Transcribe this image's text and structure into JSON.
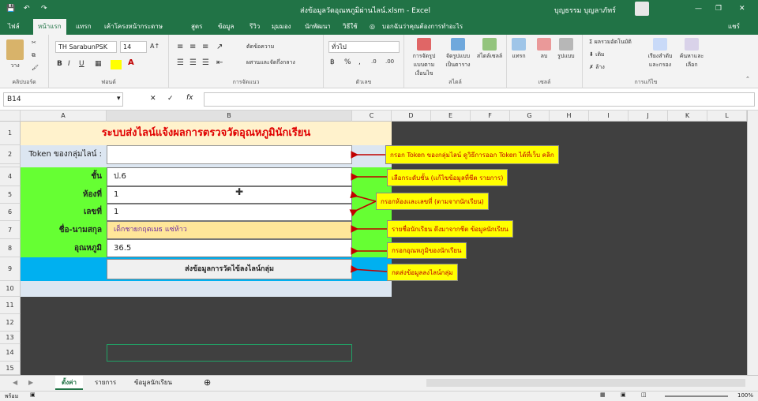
{
  "title_bar": {
    "doc_title": "ส่งข้อมูลวัดอุณหภูมิผ่านไลน์.xlsm - Excel",
    "user_name": "บุญธรรม บุญลาภัทร์",
    "min": "—",
    "restore": "❐",
    "close": "✕",
    "save_icon": "save-icon",
    "undo_icon": "undo-icon",
    "redo_icon": "redo-icon"
  },
  "ribbon_tabs": [
    "ไฟล์",
    "หน้าแรก",
    "แทรก",
    "เค้าโครงหน้ากระดาษ",
    "สูตร",
    "ข้อมูล",
    "รีวิว",
    "มุมมอง",
    "นักพัฒนา",
    "วิธีใช้"
  ],
  "tell_me": "บอกฉันว่าคุณต้องการทำอะไร",
  "share_label": "แชร์",
  "ribbon": {
    "clipboard": {
      "paste": "วาง",
      "label": "คลิปบอร์ด"
    },
    "font": {
      "name": "TH SarabunPSK",
      "size": "14",
      "label": "ฟอนต์",
      "bold": "B",
      "italic": "I",
      "underline": "U"
    },
    "alignment": {
      "wrap": "ตัดข้อความ",
      "merge": "ผสานและจัดกึ่งกลาง",
      "label": "การจัดแนว"
    },
    "number": {
      "format": "ทั่วไป",
      "label": "ตัวเลข"
    },
    "styles": {
      "conditional": "การจัดรูปแบบตามเงื่อนไข",
      "table": "จัดรูปแบบเป็นตาราง",
      "cell": "สไตล์เซลล์",
      "label": "สไตล์"
    },
    "cells": {
      "insert": "แทรก",
      "delete": "ลบ",
      "format": "รูปแบบ",
      "label": "เซลล์"
    },
    "editing": {
      "autosum": "ผลรวมอัตโนมัติ",
      "fill": "เติม",
      "clear": "ล้าง",
      "sort": "เรียงลำดับและกรอง",
      "find": "ค้นหาและเลือก",
      "label": "การแก้ไข"
    }
  },
  "formula_bar": {
    "name_box": "B14",
    "fx": "fx",
    "value": ""
  },
  "columns": [
    "A",
    "B",
    "C",
    "D",
    "E",
    "F",
    "G",
    "H",
    "I",
    "J",
    "K",
    "L"
  ],
  "rows": [
    "1",
    "2",
    "4",
    "5",
    "6",
    "7",
    "8",
    "9",
    "10",
    "11",
    "12",
    "13",
    "14",
    "15"
  ],
  "sheet": {
    "title": "ระบบส่งไลน์แจ้งผลการตรวจวัดอุณหภูมินักเรียน",
    "token_label": "Token ของกลุ่มไลน์ :",
    "token_value": "",
    "fields": [
      {
        "label": "ชั้น",
        "value": "ป.6"
      },
      {
        "label": "ห้องที่",
        "value": "1"
      },
      {
        "label": "เลขที่",
        "value": "1"
      },
      {
        "label": "ชื่อ-นามสกุล",
        "value": "เด็กชายกฤตเมธ แซ่ห้าว"
      },
      {
        "label": "อุณหภูมิ",
        "value": "36.5"
      }
    ],
    "send_button": "ส่งข้อมูลการวัดไข้ลงไลน์กลุ่ม"
  },
  "annotations": [
    "กรอก Token ของกลุ่มไลน์ ดูวิธีการออก Token ได้ที่เว็บ คลิก",
    "เลือกระดับชั้น (แก้ไขข้อมูลที่ชีต รายการ)",
    "กรอกห้องและเลขที่ (ตามจากนักเรียน)",
    "รายชื่อนักเรียน ดึงมาจากชีต ข้อมูลนักเรียน",
    "กรอกอุณหภูมิของนักเรียน",
    "กดส่งข้อมูลลงไลน์กลุ่ม"
  ],
  "sheet_tabs": [
    "ตั้งค่า",
    "รายการ",
    "ข้อมูลนักเรียน"
  ],
  "status": {
    "ready": "พร้อม",
    "zoom": "100%"
  },
  "colors": {
    "excel_green": "#217346",
    "title_bg": "#fff2cc",
    "label_green": "#66ff33",
    "button_row": "#00b0f0",
    "annotation": "#ffff00",
    "arrow": "#c00000"
  }
}
